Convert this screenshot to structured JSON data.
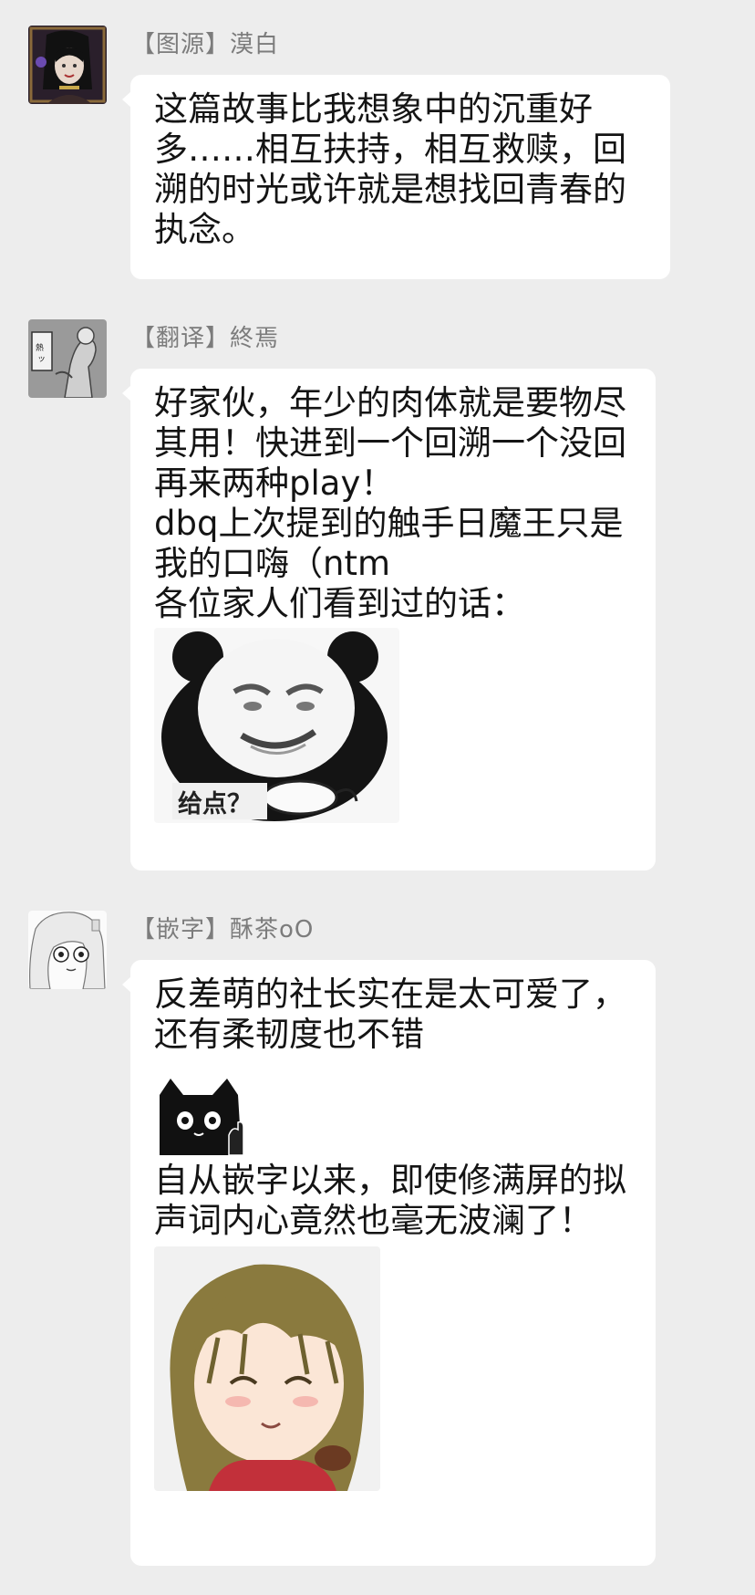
{
  "messages": [
    {
      "role": "【图源】",
      "name": "漠白",
      "text": "这篇故事比我想象中的沉重好多……相互扶持，相互救赎，回溯的时光或许就是想找回青春的执念。"
    },
    {
      "role": "【翻译】",
      "name": "終焉",
      "text_lines": [
        "好家伙，年少的肉体就是要物尽其用！快进到一个回溯一个没回再来两种play！",
        "dbq上次提到的触手日魔王只是我的口嗨（ntm",
        "各位家人们看到过的话："
      ],
      "sticker_caption": "给点？"
    },
    {
      "role": "【嵌字】",
      "name": "酥茶oO",
      "text_a": "反差萌的社长实在是太可爱了，还有柔韧度也不错",
      "text_b": "自从嵌字以来，即使修满屏的拟声词内心竟然也毫无波澜了！"
    }
  ]
}
